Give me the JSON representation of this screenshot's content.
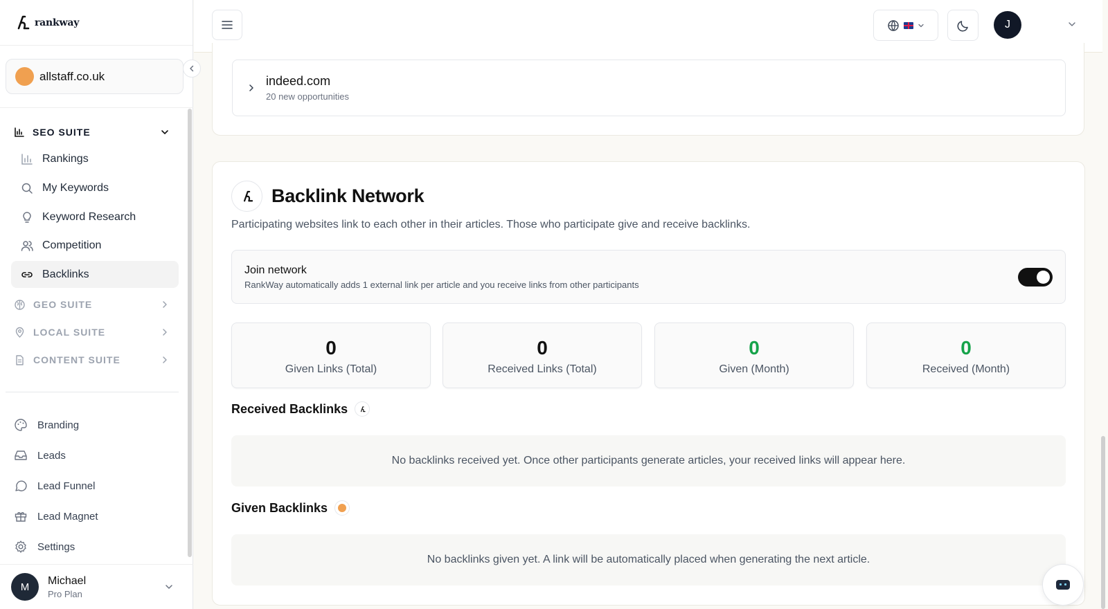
{
  "brand": {
    "name": "rankway"
  },
  "site": {
    "name": "allstaff.co.uk",
    "color": "#f0a050"
  },
  "sidebar": {
    "seo_suite": {
      "label": "SEO SUITE",
      "items": [
        {
          "label": "Rankings",
          "icon": "bar-chart-icon"
        },
        {
          "label": "My Keywords",
          "icon": "search-icon"
        },
        {
          "label": "Keyword Research",
          "icon": "lightbulb-icon"
        },
        {
          "label": "Competition",
          "icon": "users-icon"
        },
        {
          "label": "Backlinks",
          "icon": "link-icon",
          "active": true
        }
      ]
    },
    "geo_suite": {
      "label": "GEO SUITE"
    },
    "local_suite": {
      "label": "LOCAL SUITE"
    },
    "content_suite": {
      "label": "CONTENT SUITE"
    },
    "bottom_items": [
      {
        "label": "Branding",
        "icon": "palette-icon"
      },
      {
        "label": "Leads",
        "icon": "inbox-icon"
      },
      {
        "label": "Lead Funnel",
        "icon": "chat-bubble-icon"
      },
      {
        "label": "Lead Magnet",
        "icon": "gift-icon"
      },
      {
        "label": "Settings",
        "icon": "gear-icon"
      }
    ]
  },
  "user": {
    "initial": "M",
    "name": "Michael",
    "plan": "Pro Plan"
  },
  "topbar": {
    "avatar_initial": "J"
  },
  "opportunity": {
    "domain": "indeed.com",
    "subtitle": "20 new opportunities"
  },
  "backlink_network": {
    "title": "Backlink Network",
    "description": "Participating websites link to each other in their articles. Those who participate give and receive backlinks.",
    "join": {
      "title": "Join network",
      "subtitle": "RankWay automatically adds 1 external link per article and you receive links from other participants",
      "enabled": true
    },
    "stats": [
      {
        "value": "0",
        "label": "Given Links (Total)"
      },
      {
        "value": "0",
        "label": "Received Links (Total)"
      },
      {
        "value": "0",
        "label": "Given (Month)"
      },
      {
        "value": "0",
        "label": "Received (Month)"
      }
    ],
    "received": {
      "title": "Received Backlinks",
      "empty_text": "No backlinks received yet. Once other participants generate articles, your received links will appear here."
    },
    "given": {
      "title": "Given Backlinks",
      "empty_text": "No backlinks given yet. A link will be automatically placed when generating the next article."
    }
  },
  "colors": {
    "accent_green": "#16a34a",
    "orange": "#f0a050",
    "toggle_on": "#111111"
  }
}
